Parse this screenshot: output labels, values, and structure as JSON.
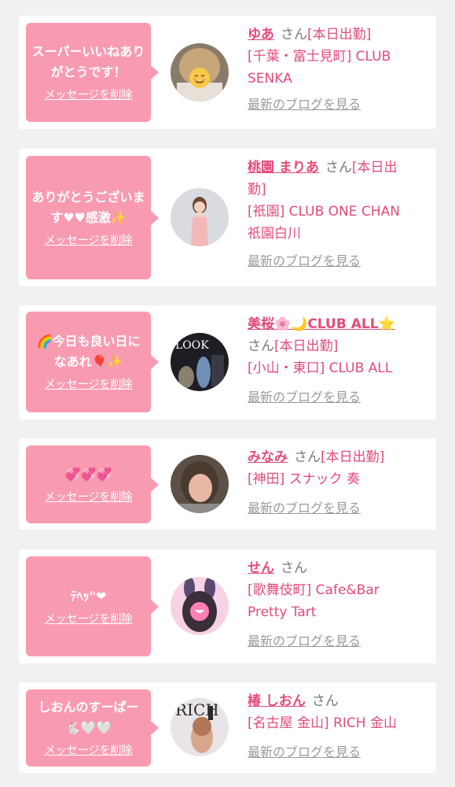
{
  "delete_label": "メッセージを削除",
  "san_label": "さん",
  "blog_label": "最新のブログを見る",
  "colors": {
    "page_bg": "#f1f1f1",
    "bubble": "#f99bb0",
    "accent_pink": "#e34b7a",
    "muted_gray": "#9a9a9a"
  },
  "messages": [
    {
      "message": "スーパーいいねありがとうです！",
      "name": "ゆあ",
      "status": "[本日出勤]",
      "shop_line1": "[千葉・富士見町] CLUB",
      "shop_line2": "SENKA",
      "avatar_icon": "girl-avatar-emoji-cover"
    },
    {
      "message": "ありがとうございます♥♥感激✨",
      "name": "桃園 まりあ",
      "status": "[本日出",
      "shop_line1": "勤]",
      "shop_line2": "[祇園] CLUB ONE CHAN",
      "shop_line3": "祇園白川",
      "avatar_icon": "woman-portrait-avatar"
    },
    {
      "message": "🌈今日も良い日になあれ🎈✨",
      "name": "美桜🌸🌙CLUB ALL⭐",
      "status": "[本日出勤]",
      "shop_line1": "[小山・東口] CLUB ALL",
      "avatar_icon": "look-sign-avatar"
    },
    {
      "message": "💞💞💞",
      "name": "みなみ",
      "status": "[本日出勤]",
      "shop_line1": "[神田] スナック 奏",
      "avatar_icon": "woman-selfie-avatar"
    },
    {
      "message": "ﾃﾍｯ\"❤",
      "name": "せん",
      "status": "",
      "shop_line1": "[歌舞伎町] Cafe&Bar",
      "shop_line2": "Pretty Tart",
      "avatar_icon": "bunny-ears-avatar"
    },
    {
      "message": "しおんのすーぱー🐇🤍🤍",
      "name": "椿 しおん",
      "status": "",
      "shop_line1": "[名古屋 金山] RICH 金山",
      "avatar_icon": "magazine-cover-avatar"
    }
  ]
}
